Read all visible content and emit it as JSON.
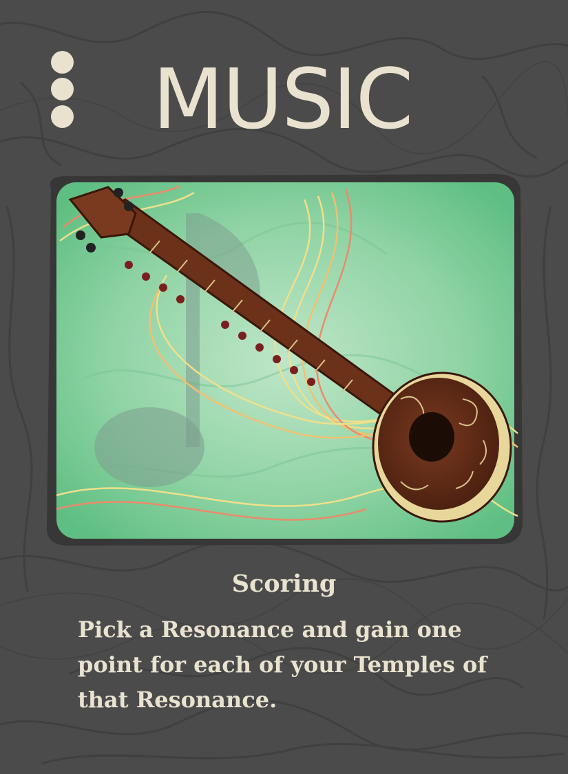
{
  "card": {
    "title": "MUSIC",
    "cost_pips": 3,
    "illustration": {
      "subject": "sitar-icon",
      "background": "music-note-icon"
    },
    "scoring": {
      "heading": "Scoring",
      "text": "Pick a Resonance and gain one point for each of your Temples of that Resonance."
    }
  },
  "colors": {
    "background": "#4b4b4c",
    "ink": "#e9e2ce",
    "art_green": "#7fc99a",
    "wood": "#5a2a17"
  }
}
